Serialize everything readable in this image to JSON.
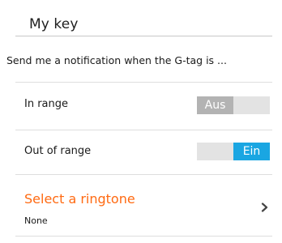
{
  "device_name": "My key",
  "notification_prompt": "Send me a notification when the G-tag is ...",
  "in_range": {
    "label": "In range",
    "state_label": "Aus",
    "enabled": false
  },
  "out_of_range": {
    "label": "Out of range",
    "state_label": "Ein",
    "enabled": true
  },
  "ringtone": {
    "title": "Select a ringtone",
    "value": "None"
  },
  "colors": {
    "accent_orange": "#ff6a12",
    "toggle_on": "#1aa6e2",
    "toggle_off": "#b3b3b3",
    "track": "#e3e3e3"
  },
  "icons": {
    "ringtone_chevron": "chevron-right-icon"
  }
}
